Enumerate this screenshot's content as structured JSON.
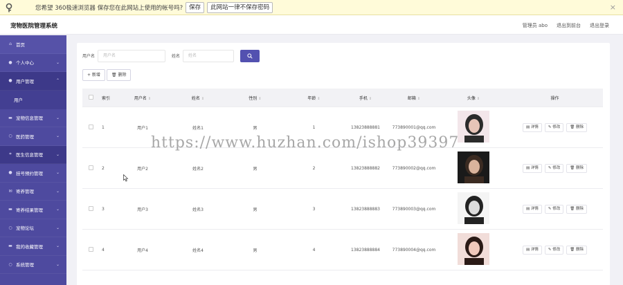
{
  "browser_bar": {
    "message": "您希望 360极速浏览器 保存您在此网站上使用的帐号吗?",
    "save_btn": "保存",
    "never_btn": "此网站一律不保存密码",
    "close": "×"
  },
  "header": {
    "title": "宠物医院管理系统",
    "user": "管理员 abo",
    "to_frontend": "退出到前台",
    "logout": "退出登录"
  },
  "sidebar": {
    "items": [
      {
        "label": "首页",
        "icon": "home-icon"
      },
      {
        "label": "个人中心",
        "icon": "person-icon"
      },
      {
        "label": "用户管理",
        "icon": "person-icon"
      },
      {
        "label": "宠物信息管理",
        "icon": "chat-icon"
      },
      {
        "label": "医药管理",
        "icon": "circle-icon"
      },
      {
        "label": "医生信息管理",
        "icon": "scan-icon"
      },
      {
        "label": "挂号预约管理",
        "icon": "person-icon"
      },
      {
        "label": "寄养管理",
        "icon": "mail-icon"
      },
      {
        "label": "寄养结果管理",
        "icon": "chat-icon"
      },
      {
        "label": "宠物论坛",
        "icon": "circle-icon"
      },
      {
        "label": "我的收藏管理",
        "icon": "chat-icon"
      },
      {
        "label": "系统管理",
        "icon": "circle-icon"
      }
    ],
    "sub_user": "用户"
  },
  "search": {
    "username_label": "用户名",
    "username_placeholder": "用户名",
    "name_label": "姓名",
    "name_placeholder": "姓名"
  },
  "toolbar": {
    "add": "+ 新增",
    "delete": "🗑 删除"
  },
  "table": {
    "headers": [
      "索引",
      "用户名",
      "姓名",
      "性别",
      "年龄",
      "手机",
      "邮箱",
      "头像",
      "操作"
    ],
    "rows": [
      {
        "idx": "1",
        "username": "用户1",
        "name": "姓名1",
        "sex": "男",
        "age": "1",
        "phone": "13823888881",
        "email": "773890001@qq.com"
      },
      {
        "idx": "2",
        "username": "用户2",
        "name": "姓名2",
        "sex": "男",
        "age": "2",
        "phone": "13823888882",
        "email": "773890002@qq.com"
      },
      {
        "idx": "3",
        "username": "用户3",
        "name": "姓名3",
        "sex": "男",
        "age": "3",
        "phone": "13823888883",
        "email": "773890003@qq.com"
      },
      {
        "idx": "4",
        "username": "用户4",
        "name": "姓名4",
        "sex": "男",
        "age": "4",
        "phone": "13823888884",
        "email": "773890004@qq.com"
      }
    ],
    "ops": {
      "detail": "详情",
      "edit": "修改",
      "del": "删除"
    }
  },
  "watermark": "https://www.huzhan.com/ishop39397",
  "colors": {
    "sidebar": "#4e4a9f",
    "accent": "#5351b0"
  }
}
